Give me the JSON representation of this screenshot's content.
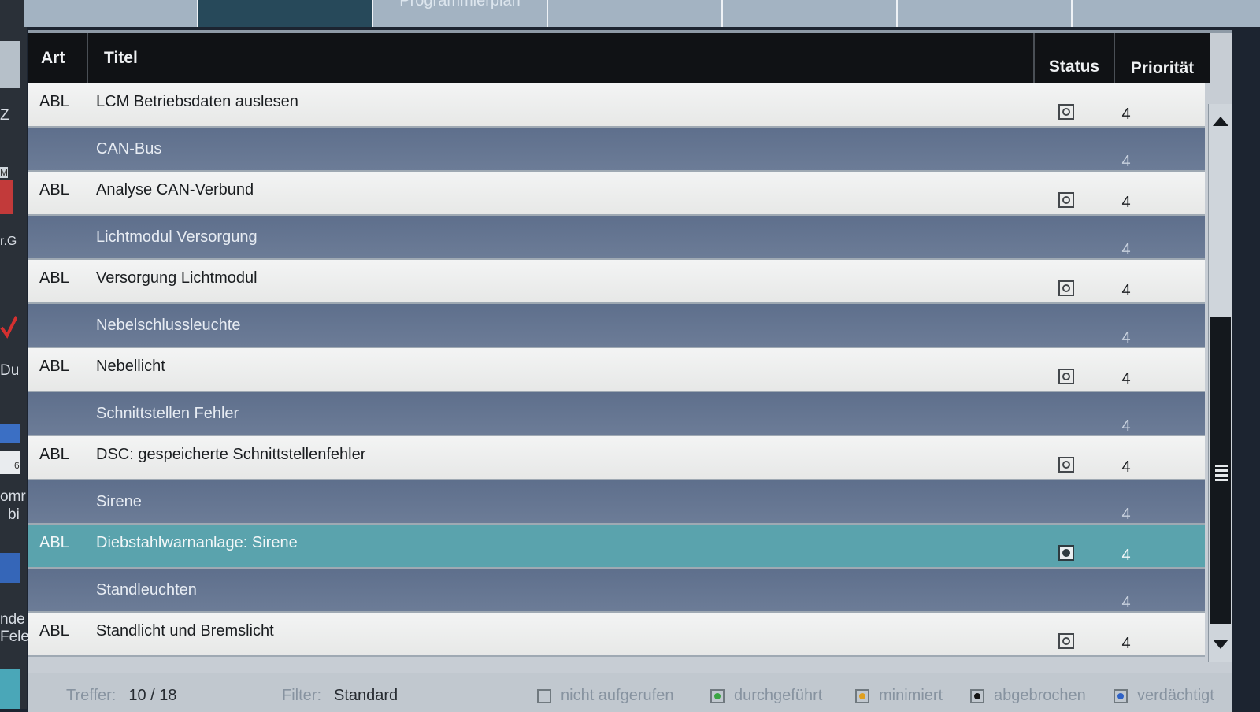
{
  "tabs": [
    {
      "label": ""
    },
    {
      "label": ""
    },
    {
      "label": "Programmierplan"
    },
    {
      "label": ""
    },
    {
      "label": ""
    },
    {
      "label": ""
    },
    {
      "label": ""
    }
  ],
  "table": {
    "columns": {
      "art": "Art",
      "titel": "Titel",
      "status": "Status",
      "prioritaet": "Priorität"
    },
    "rows": [
      {
        "type": "abl",
        "art": "ABL",
        "titel": "LCM Betriebsdaten auslesen",
        "prio": "4"
      },
      {
        "type": "group",
        "art": "",
        "titel": "CAN-Bus",
        "prio": "4"
      },
      {
        "type": "abl",
        "art": "ABL",
        "titel": "Analyse CAN-Verbund",
        "prio": "4"
      },
      {
        "type": "group",
        "art": "",
        "titel": "Lichtmodul Versorgung",
        "prio": "4"
      },
      {
        "type": "abl",
        "art": "ABL",
        "titel": "Versorgung Lichtmodul",
        "prio": "4"
      },
      {
        "type": "group",
        "art": "",
        "titel": "Nebelschlussleuchte",
        "prio": "4"
      },
      {
        "type": "abl",
        "art": "ABL",
        "titel": "Nebellicht",
        "prio": "4"
      },
      {
        "type": "group",
        "art": "",
        "titel": "Schnittstellen Fehler",
        "prio": "4"
      },
      {
        "type": "abl",
        "art": "ABL",
        "titel": "DSC: gespeicherte Schnittstellenfehler",
        "prio": "4"
      },
      {
        "type": "group",
        "art": "",
        "titel": "Sirene",
        "prio": "4"
      },
      {
        "type": "selected",
        "art": "ABL",
        "titel": "Diebstahlwarnanlage: Sirene",
        "prio": "4"
      },
      {
        "type": "group",
        "art": "",
        "titel": "Standleuchten",
        "prio": "4"
      },
      {
        "type": "abl",
        "art": "ABL",
        "titel": "Standlicht und Bremslicht",
        "prio": "4"
      }
    ]
  },
  "footer": {
    "treffer_label": "Treffer:",
    "treffer_value": "10 / 18",
    "filter_label": "Filter:",
    "filter_value": "Standard",
    "legend": [
      {
        "label": "nicht aufgerufen",
        "color": ""
      },
      {
        "label": "durchgeführt",
        "color": "#3aa542"
      },
      {
        "label": "minimiert",
        "color": "#e0a020"
      },
      {
        "label": "abgebrochen",
        "color": "#151515"
      },
      {
        "label": "verdächtigt",
        "color": "#2f62c6"
      }
    ]
  },
  "left_fragments": [
    "Z",
    "M",
    "r.G",
    "Du",
    "6",
    "omr",
    "bi",
    "nde",
    "Fele"
  ],
  "colors": {
    "header_bg": "#101215",
    "group_row": "#627390",
    "selected_row": "#5aa3ad",
    "abl_row": "#efefef"
  }
}
